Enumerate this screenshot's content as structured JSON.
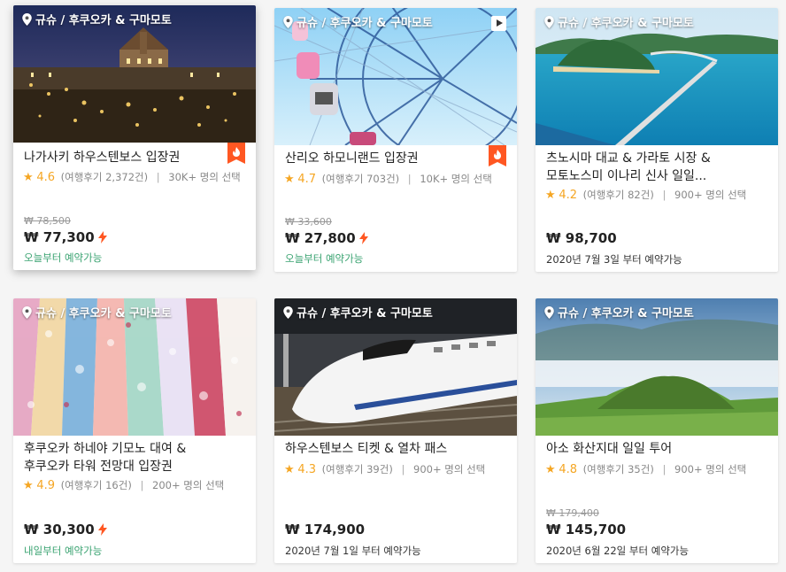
{
  "cards": [
    {
      "location": "규슈 / 후쿠오카 & 구마모토",
      "title": "나가사키 하우스텐보스 입장권",
      "score": "4.6",
      "reviews": "(여행후기 2,372건)",
      "selected": "30K+ 명의 선택",
      "original_price": "₩ 78,500",
      "price": "₩ 77,300",
      "availability": "오늘부터 예약가능",
      "hot_badge": "fire-icon",
      "instant": "lightning-icon"
    },
    {
      "location": "규슈 / 후쿠오카 & 구마모토",
      "title": "산리오 하모니랜드 입장권",
      "score": "4.7",
      "reviews": "(여행후기 703건)",
      "selected": "10K+ 명의 선택",
      "original_price": "₩ 33,600",
      "price": "₩ 27,800",
      "availability": "오늘부터 예약가능",
      "hot_badge": "fire-icon",
      "video_icon": "play-icon",
      "instant": "lightning-icon"
    },
    {
      "location": "규슈 / 후쿠오카 & 구마모토",
      "title_line1": "츠노시마 대교 & 가라토 시장 &",
      "title_line2": "모토노스미 이나리 신사 일일...",
      "score": "4.2",
      "reviews": "(여행후기 82건)",
      "selected": "900+ 명의 선택",
      "price": "₩ 98,700",
      "availability": "2020년 7월 3일 부터 예약가능"
    },
    {
      "location": "규슈 / 후쿠오카 & 구마모토",
      "title_line1": "후쿠오카 하네야 기모노 대여 &",
      "title_line2": "후쿠오카 타워 전망대 입장권",
      "score": "4.9",
      "reviews": "(여행후기 16건)",
      "selected": "200+ 명의 선택",
      "price": "₩ 30,300",
      "availability": "내일부터 예약가능",
      "instant": "lightning-icon"
    },
    {
      "location": "규슈 / 후쿠오카 & 구마모토",
      "title": "하우스텐보스 티켓 & 열차 패스",
      "score": "4.3",
      "reviews": "(여행후기 39건)",
      "selected": "900+ 명의 선택",
      "price": "₩ 174,900",
      "availability": "2020년 7월 1일 부터 예약가능"
    },
    {
      "location": "규슈 / 후쿠오카 & 구마모토",
      "title": "아소 화산지대 일일 투어",
      "score": "4.8",
      "reviews": "(여행후기 35건)",
      "selected": "900+ 명의 선택",
      "original_price": "₩ 179,400",
      "price": "₩ 145,700",
      "availability": "2020년 6월 22일 부터 예약가능"
    }
  ],
  "colors": {
    "star": "#f5a623",
    "availability_green": "#3aa371",
    "hot_badge": "#ff5722",
    "lightning": "#ff5722"
  }
}
